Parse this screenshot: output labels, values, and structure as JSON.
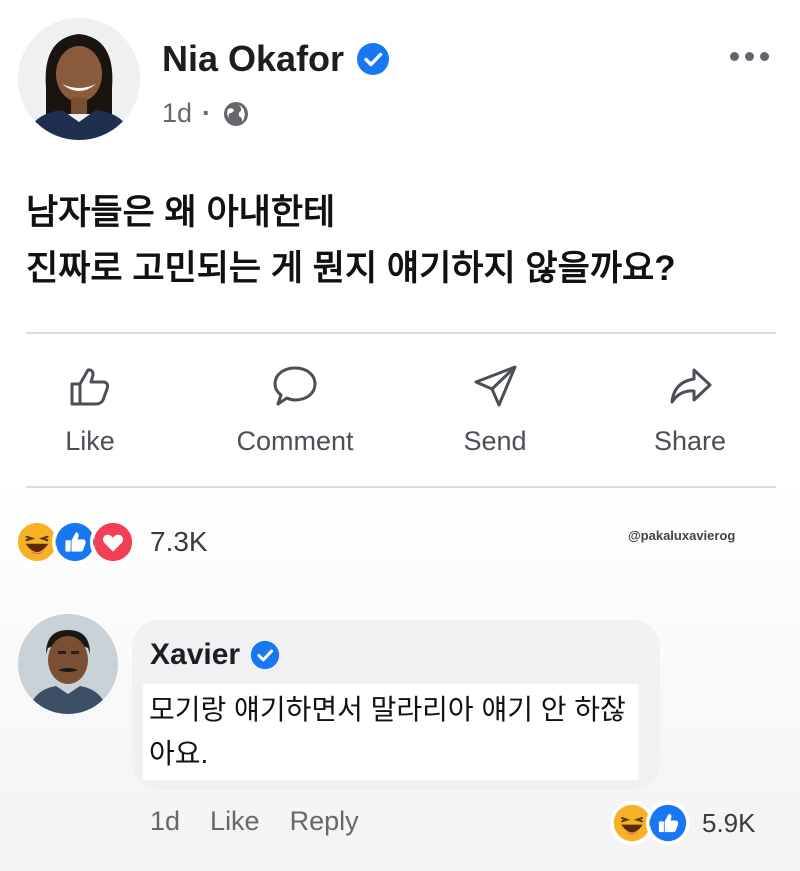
{
  "post": {
    "author": "Nia Okafor",
    "age": "1d",
    "separator": "·",
    "line1": "남자들은 왜 아내한테",
    "line2": "진짜로 고민되는 게 뭔지 얘기하지 않을까요?"
  },
  "actions": {
    "like": "Like",
    "comment": "Comment",
    "send": "Send",
    "share": "Share"
  },
  "reactions": {
    "icons": [
      "haha-icon",
      "like-icon",
      "love-icon"
    ],
    "count": "7.3K"
  },
  "watermark": "@pakaluxavierog",
  "comment": {
    "author": "Xavier",
    "text": "모기랑 얘기하면서 말라리아 얘기 안 하잖아요.",
    "age": "1d",
    "like": "Like",
    "reply": "Reply",
    "reactions": {
      "icons": [
        "haha-icon",
        "like-icon"
      ],
      "count": "5.9K"
    }
  },
  "colors": {
    "facebook_blue": "#1877f2",
    "love_red": "#f33e58",
    "haha_yellow": "#f7b125",
    "meta_gray": "#65676b"
  }
}
